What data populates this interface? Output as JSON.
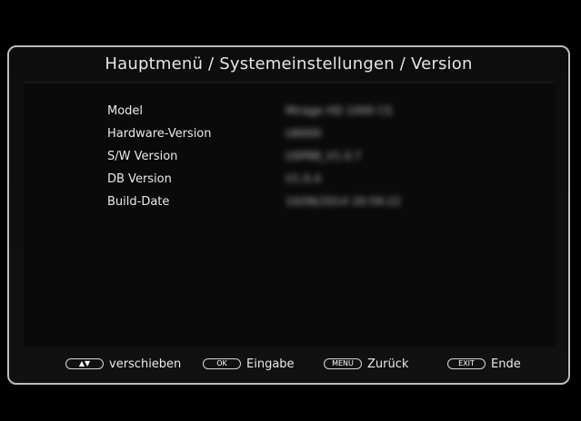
{
  "title": "Hauptmenü / Systemeinstellungen / Version",
  "info": {
    "rows": [
      {
        "label": "Model",
        "value": "Mirage HD 1000 CS"
      },
      {
        "label": "Hardware-Version",
        "value": "U6000"
      },
      {
        "label": "S/W Version",
        "value": "USP88_V1.0.7"
      },
      {
        "label": "DB Version",
        "value": "V1.0.4"
      },
      {
        "label": "Build-Date",
        "value": "10/06/2014 20:59:22"
      }
    ]
  },
  "footer": {
    "items": [
      {
        "key": "▲▼",
        "label": "verschieben"
      },
      {
        "key": "OK",
        "label": "Eingabe"
      },
      {
        "key": "MENU",
        "label": "Zurück"
      },
      {
        "key": "EXIT",
        "label": "Ende"
      }
    ]
  }
}
